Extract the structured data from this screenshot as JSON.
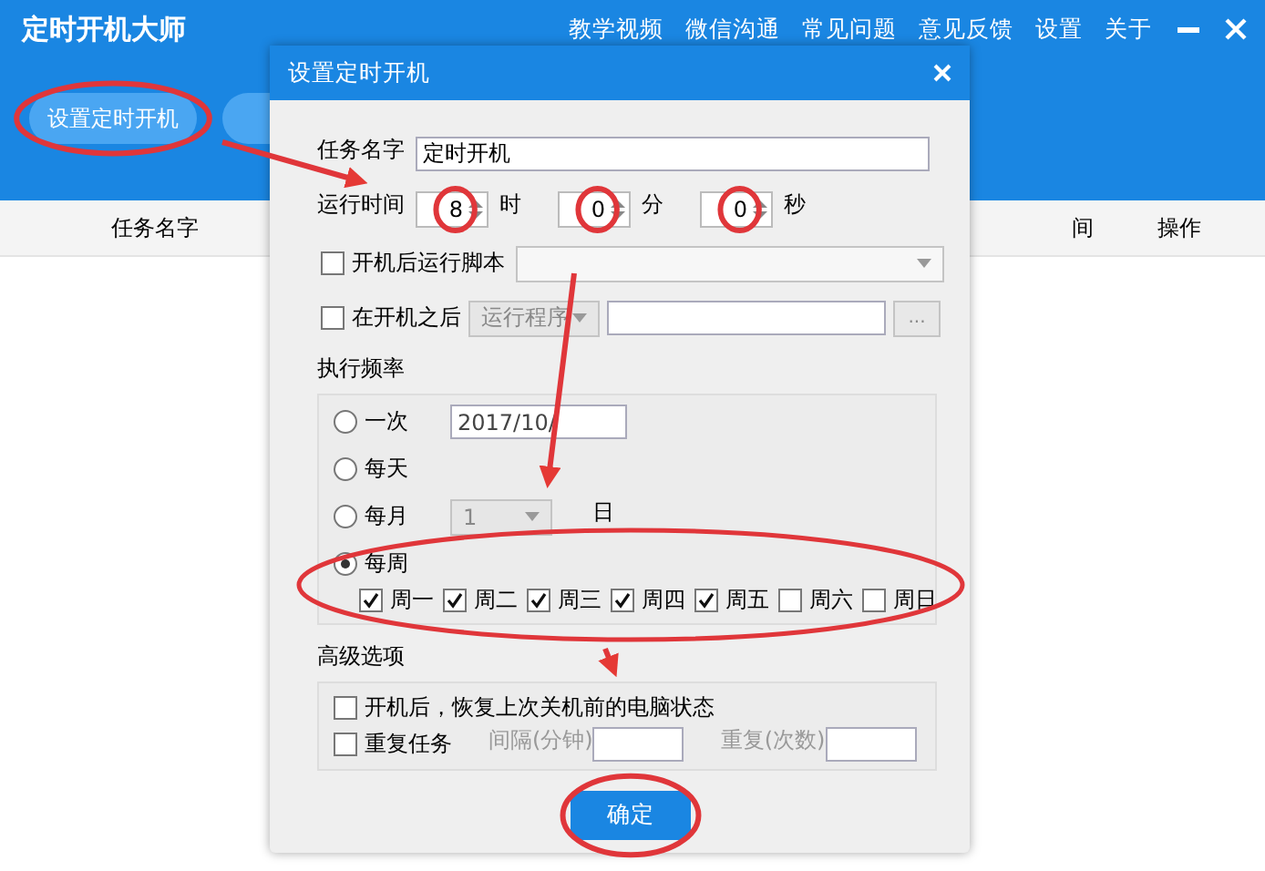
{
  "app": {
    "title": "定时开机大师",
    "menu": [
      "教学视频",
      "微信沟通",
      "常见问题",
      "意见反馈",
      "设置",
      "关于"
    ]
  },
  "toolbar": {
    "buttons": [
      "设置定时开机"
    ]
  },
  "table": {
    "columns": [
      "任务名字",
      "间",
      "操作"
    ]
  },
  "dialog": {
    "title": "设置定时开机",
    "task_name": {
      "label": "任务名字",
      "value": "定时开机"
    },
    "run_time": {
      "label": "运行时间",
      "fields": [
        {
          "value": "8",
          "unit": "时"
        },
        {
          "value": "0",
          "unit": "分"
        },
        {
          "value": "0",
          "unit": "秒"
        }
      ]
    },
    "script": {
      "label": "开机后运行脚本",
      "checked": false
    },
    "after_boot": {
      "label": "在开机之后",
      "checked": false,
      "program": "运行程序",
      "browse": "..."
    },
    "frequency": {
      "label": "执行频率",
      "options": [
        {
          "kind": "date",
          "label": "一次",
          "selected": false,
          "value": "2017/10/"
        },
        {
          "kind": "plain",
          "label": "每天",
          "selected": false
        },
        {
          "kind": "monthday",
          "label": "每月",
          "selected": false,
          "value": "1",
          "suffix": "日"
        },
        {
          "kind": "weekdays",
          "label": "每周",
          "selected": true,
          "days": [
            {
              "label": "周一",
              "checked": true
            },
            {
              "label": "周二",
              "checked": true
            },
            {
              "label": "周三",
              "checked": true
            },
            {
              "label": "周四",
              "checked": true
            },
            {
              "label": "周五",
              "checked": true
            },
            {
              "label": "周六",
              "checked": false
            },
            {
              "label": "周日",
              "checked": false
            }
          ]
        }
      ]
    },
    "advanced": {
      "label": "高级选项",
      "restore": {
        "label": "开机后，恢复上次关机前的电脑状态",
        "checked": false
      },
      "repeat": {
        "label": "重复任务",
        "checked": false,
        "interval_label": "间隔(分钟)",
        "count_label": "重复(次数)"
      }
    },
    "ok": "确定"
  }
}
